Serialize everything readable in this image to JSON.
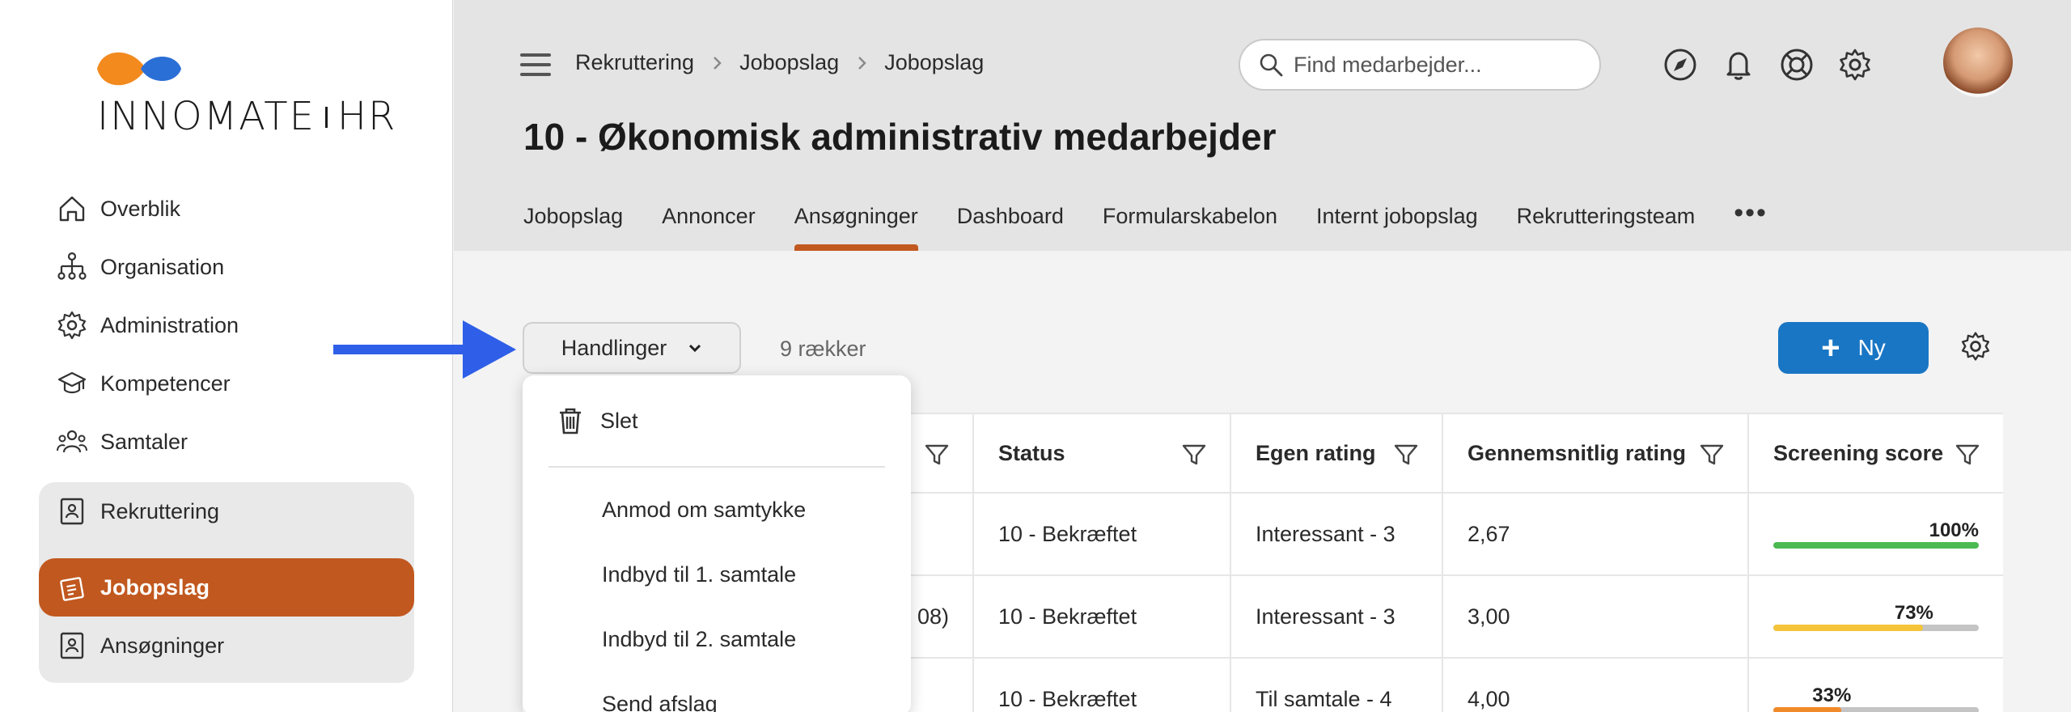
{
  "brand": {
    "name_left": "INNOMATE",
    "name_right": "HR",
    "colors": {
      "orange": "#f28a1e",
      "blue": "#2a6fd6"
    }
  },
  "sidebar": {
    "items": [
      {
        "label": "Overblik",
        "icon": "home-icon"
      },
      {
        "label": "Organisation",
        "icon": "org-chart-icon"
      },
      {
        "label": "Administration",
        "icon": "gear-icon"
      },
      {
        "label": "Kompetencer",
        "icon": "graduation-cap-icon"
      },
      {
        "label": "Samtaler",
        "icon": "people-icon"
      }
    ],
    "group": {
      "label": "Rekruttering",
      "icon": "badge-icon",
      "children": [
        {
          "label": "Jobopslag",
          "icon": "job-post-icon",
          "active": true
        },
        {
          "label": "Ansøgninger",
          "icon": "badge-icon"
        }
      ]
    },
    "active_color": "#c1581f"
  },
  "header": {
    "breadcrumb": [
      "Rekruttering",
      "Jobopslag",
      "Jobopslag"
    ],
    "search_placeholder": "Find medarbejder...",
    "icons": [
      "navigate-icon",
      "bell-icon",
      "lifebuoy-icon",
      "gear-icon"
    ],
    "title": "10 - Økonomisk administrativ medarbejder",
    "tabs": [
      "Jobopslag",
      "Annoncer",
      "Ansøgninger",
      "Dashboard",
      "Formularskabelon",
      "Internt jobopslag",
      "Rekrutteringsteam"
    ],
    "active_tab": "Ansøgninger",
    "more": "•••"
  },
  "toolbar": {
    "actions_label": "Handlinger",
    "row_count": "9 rækker",
    "new_label": "Ny",
    "new_color": "#1976c4"
  },
  "menu": {
    "delete_label": "Slet",
    "items": [
      "Anmod om samtykke",
      "Indbyd til 1. samtale",
      "Indbyd til 2. samtale",
      "Send afslag"
    ]
  },
  "table": {
    "columns": [
      "",
      "Status",
      "Egen rating",
      "Gennemsnitlig rating",
      "Screening score"
    ],
    "rows": [
      {
        "c0": "",
        "status": "10 - Bekræftet",
        "own": "Interessant - 3",
        "avg": "2,67",
        "score_label": "100%",
        "score": 100,
        "score_color": "#4cba52"
      },
      {
        "c0": "08)",
        "status": "10 - Bekræftet",
        "own": "Interessant - 3",
        "avg": "3,00",
        "score_label": "73%",
        "score": 73,
        "score_color": "#f5c43a"
      },
      {
        "c0": "",
        "status": "10 - Bekræftet",
        "own": "Til samtale - 4",
        "avg": "4,00",
        "score_label": "33%",
        "score": 33,
        "score_color": "#f08a2a"
      }
    ]
  }
}
